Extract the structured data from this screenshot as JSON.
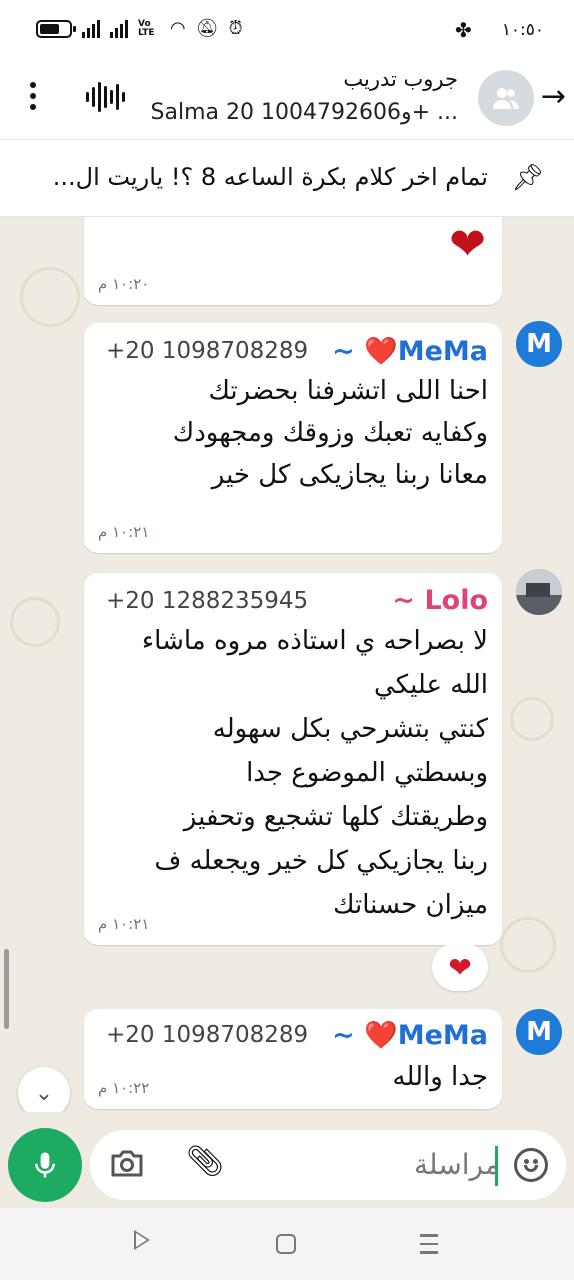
{
  "status_bar": {
    "time": "١٠:٥٠",
    "volte": "Vo LTE"
  },
  "header": {
    "title": "جروب تدريب",
    "subtitle": "Salma و1004792606 20+ ..."
  },
  "pinned": {
    "text": "تمام اخر كلام بكرة الساعه 8 ؟! ياريت ال..."
  },
  "messages": [
    {
      "type": "partial",
      "text": "❤",
      "time": "١٠:٢٠ م"
    },
    {
      "sender": "MeMa❤️ ~",
      "phone": "+20 1098708289",
      "avatar": "M",
      "lines": [
        "احنا اللى اتشرفنا بحضرتك",
        "وكفايه تعبك وزوقك ومجهودك",
        "معانا ربنا يجازيكى كل خير"
      ],
      "time": "١٠:٢١ م"
    },
    {
      "sender": "Lolo ~",
      "phone": "+20 1288235945",
      "lines": [
        "لا بصراحه ي استاذه مروه ماشاء",
        "الله عليكي",
        "كنتي بتشرحي بكل سهوله",
        "وبسطتي الموضوع جدا",
        "وطريقتك كلها تشجيع وتحفيز",
        "ربنا يجازيكي كل خير ويجعله ف",
        "ميزان حسناتك"
      ],
      "time": "١٠:٢١ م",
      "reaction": "❤"
    },
    {
      "sender": "MeMa❤️ ~",
      "phone": "+20 1098708289",
      "avatar": "M",
      "lines": [
        "جدا والله"
      ],
      "time": "١٠:٢٢ م"
    }
  ],
  "input": {
    "placeholder": "مراسلة"
  },
  "colors": {
    "wa_green": "#1daa61",
    "mema_blue": "#1f6fd6",
    "lolo_pink": "#e0437a",
    "chat_bg": "#efeae2"
  },
  "icons": [
    "back-arrow-icon",
    "group-avatar-icon",
    "voice-call-icon",
    "menu-icon",
    "pin-icon",
    "mic-icon",
    "camera-icon",
    "attach-icon",
    "emoji-icon"
  ]
}
